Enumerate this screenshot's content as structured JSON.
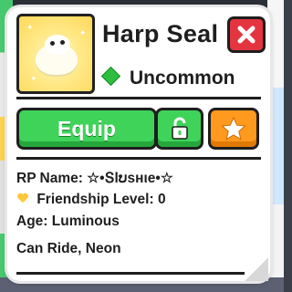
{
  "pet": {
    "name": "Harp Seal",
    "rarity": "Uncommon",
    "rarity_color": "#2ebd3e",
    "thumbnail_icon": "harp-seal-icon"
  },
  "actions": {
    "equip_label": "Equip",
    "lock_icon": "lock-icon",
    "favorite_icon": "star-icon",
    "close_icon": "close-icon"
  },
  "details": {
    "rp_name_label": "RP Name:",
    "rp_name_value": "☆•Տlບsнιe•☆",
    "friendship_label": "Friendship Level:",
    "friendship_value": "0",
    "age_label": "Age:",
    "age_value": "Luminous",
    "traits": "Can Ride, Neon"
  },
  "colors": {
    "equip_green": "#3fd35a",
    "favorite_orange": "#ff9a1f",
    "close_red": "#e4343f",
    "heart_yellow": "#ffc83a"
  }
}
